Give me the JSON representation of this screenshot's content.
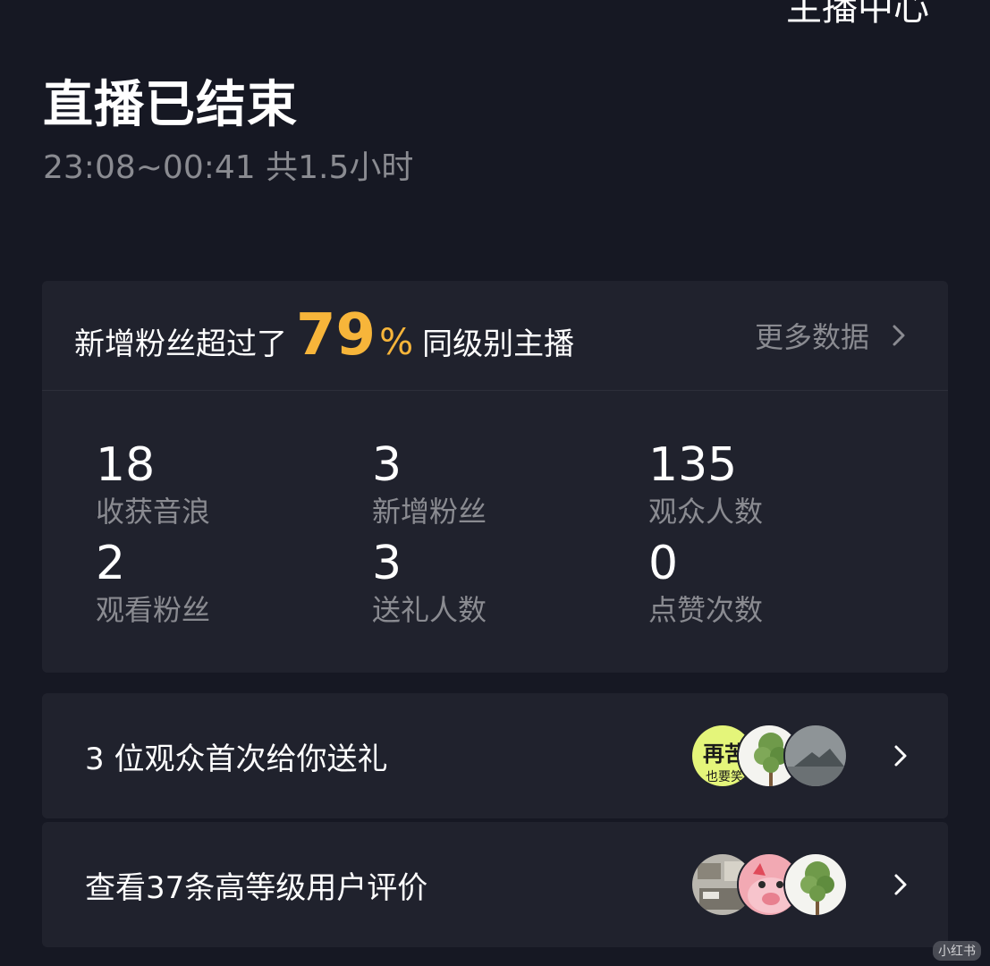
{
  "header": {
    "top_right_partial": "主播中心",
    "title": "直播已结束",
    "time_range": "23:08~00:41 共1.5小时"
  },
  "summary": {
    "prefix": "新增粉丝超过了",
    "percent_value": "79",
    "percent_sign": "%",
    "suffix": "同级别主播",
    "more_label": "更多数据",
    "accent_color": "#f7b53a"
  },
  "stats": [
    {
      "value": "18",
      "label": "收获音浪"
    },
    {
      "value": "3",
      "label": "新增粉丝"
    },
    {
      "value": "135",
      "label": "观众人数"
    },
    {
      "value": "2",
      "label": "观看粉丝"
    },
    {
      "value": "3",
      "label": "送礼人数"
    },
    {
      "value": "0",
      "label": "点赞次数"
    }
  ],
  "gift_row": {
    "text": "3 位观众首次给你送礼",
    "avatars": [
      "avatar-calligraphy",
      "avatar-tree",
      "avatar-misty-landscape"
    ],
    "avatar_text": [
      "再苦",
      "也要笑"
    ]
  },
  "review_row": {
    "text": "查看37条高等级用户评价",
    "avatars": [
      "avatar-room-photo",
      "avatar-cartoon-pig",
      "avatar-tree"
    ]
  },
  "watermark": "小红书"
}
